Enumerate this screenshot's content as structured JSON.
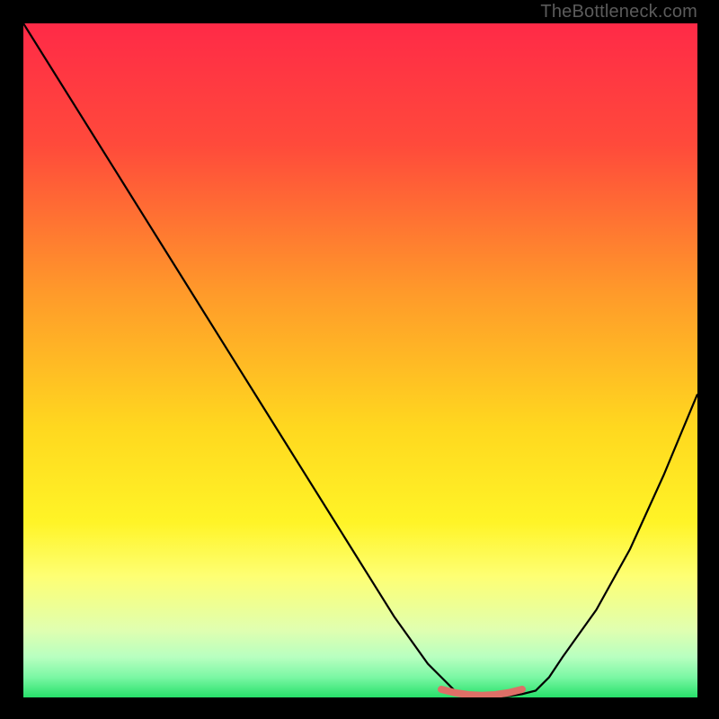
{
  "watermark": "TheBottleneck.com",
  "chart_data": {
    "type": "line",
    "title": "",
    "xlabel": "",
    "ylabel": "",
    "xlim": [
      0,
      100
    ],
    "ylim": [
      0,
      100
    ],
    "background_gradient": {
      "stops": [
        {
          "offset": 0.0,
          "color": "#ff2a47"
        },
        {
          "offset": 0.18,
          "color": "#ff4a3b"
        },
        {
          "offset": 0.4,
          "color": "#ff9a2a"
        },
        {
          "offset": 0.6,
          "color": "#ffd81f"
        },
        {
          "offset": 0.74,
          "color": "#fff427"
        },
        {
          "offset": 0.82,
          "color": "#feff73"
        },
        {
          "offset": 0.9,
          "color": "#e0ffb0"
        },
        {
          "offset": 0.94,
          "color": "#b8ffc0"
        },
        {
          "offset": 0.97,
          "color": "#7bf7a4"
        },
        {
          "offset": 1.0,
          "color": "#27e06a"
        }
      ]
    },
    "series": [
      {
        "name": "bottleneck-curve",
        "color": "#000000",
        "width": 2.2,
        "x": [
          0,
          5,
          10,
          15,
          20,
          25,
          30,
          35,
          40,
          45,
          50,
          55,
          60,
          62,
          64,
          66,
          68,
          70,
          72,
          74,
          76,
          78,
          80,
          85,
          90,
          95,
          100
        ],
        "y": [
          100,
          92,
          84,
          76,
          68,
          60,
          52,
          44,
          36,
          28,
          20,
          12,
          5,
          3,
          1,
          0.5,
          0.2,
          0.1,
          0.2,
          0.5,
          1,
          3,
          6,
          13,
          22,
          33,
          45
        ]
      },
      {
        "name": "flat-bottom-marker",
        "color": "#de6f67",
        "width": 8,
        "linecap": "round",
        "x": [
          62,
          64,
          66,
          68,
          70,
          72,
          74
        ],
        "y": [
          1.2,
          0.7,
          0.4,
          0.3,
          0.4,
          0.7,
          1.2
        ]
      }
    ]
  }
}
